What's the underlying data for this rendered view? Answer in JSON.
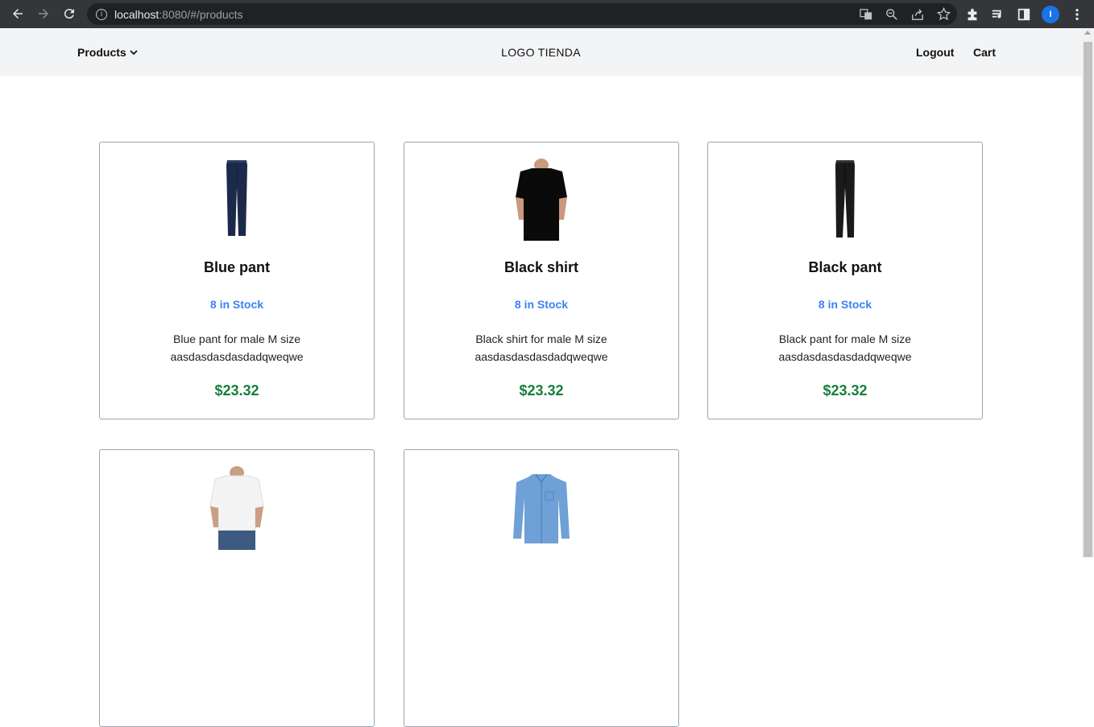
{
  "browser": {
    "url_host": "localhost",
    "url_rest": ":8080/#/products",
    "avatar_letter": "I",
    "icons": [
      "back-icon",
      "forward-icon",
      "reload-icon",
      "info-icon",
      "translate-icon",
      "zoom-icon",
      "share-icon",
      "star-icon",
      "extensions-icon",
      "media-icon",
      "sidepanel-icon",
      "menu-icon"
    ]
  },
  "header": {
    "products_label": "Products",
    "logo": "LOGO TIENDA",
    "logout_label": "Logout",
    "cart_label": "Cart"
  },
  "products": [
    {
      "name": "Blue pant",
      "stock": "8 in Stock",
      "desc_line1": "Blue pant for male M size",
      "desc_line2": "aasdasdasdasdadqweqwe",
      "price": "$23.32",
      "image": "blue-pant",
      "color": "#1b2a4a"
    },
    {
      "name": "Black shirt",
      "stock": "8 in Stock",
      "desc_line1": "Black shirt for male M size",
      "desc_line2": "aasdasdasdasdadqweqwe",
      "price": "$23.32",
      "image": "black-shirt",
      "color": "#0a0a0a"
    },
    {
      "name": "Black pant",
      "stock": "8 in Stock",
      "desc_line1": "Black pant for male M size",
      "desc_line2": "aasdasdasdasdadqweqwe",
      "price": "$23.32",
      "image": "black-pant",
      "color": "#1a1a1a"
    },
    {
      "name": "",
      "stock": "",
      "desc_line1": "",
      "desc_line2": "",
      "price": "",
      "image": "white-shirt",
      "color": "#f4f4f4"
    },
    {
      "name": "",
      "stock": "",
      "desc_line1": "",
      "desc_line2": "",
      "price": "",
      "image": "blue-shirt",
      "color": "#6fa0d6"
    }
  ],
  "colors": {
    "stock": "#3b82f6",
    "price": "#15803d",
    "header_bg": "#f3f4f6"
  }
}
